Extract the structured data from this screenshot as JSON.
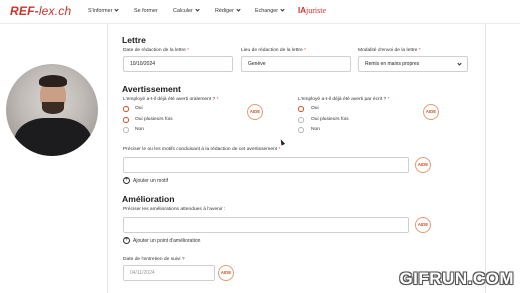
{
  "header": {
    "logo_main": "REF",
    "logo_sep": "-",
    "logo_lex": "lex.ch",
    "nav": [
      "S'informer",
      "Se former",
      "Calculer",
      "Rédiger",
      "Echanger"
    ],
    "brand_ia": "IA",
    "brand_rest": "juriste"
  },
  "lettre": {
    "title": "Lettre",
    "date_label": "Date de rédaction de la lettre",
    "date_value": "10/10/2024",
    "lieu_label": "Lieu de rédaction de la lettre",
    "lieu_value": "Genève",
    "modalite_label": "Modalité d'envoi de la lettre",
    "modalite_value": "Remis en mains propres"
  },
  "avertissement": {
    "title": "Avertissement",
    "oral_question": "L'employé a-t-il déjà été averti oralement ?",
    "ecrit_question": "L'employé a-t-il déjà été averti par écrit ?",
    "oral_options": [
      "Oui",
      "Oui plusieurs fois",
      "Non"
    ],
    "oral_selected": 1,
    "ecrit_options": [
      "Oui",
      "Oui plusieurs fois",
      "Non"
    ],
    "ecrit_selected": 0,
    "motifs_label": "Préciser le ou les motifs conduisant à la rédaction de cet avertissement",
    "add_motif": "Ajouter un motif"
  },
  "amelioration": {
    "title": "Amélioration",
    "label": "Préciser les améliorations attendues à l'avenir :",
    "add_point": "Ajouter un point d'amélioration",
    "suivi_label": "Date de l'entretien de suivi ?",
    "suivi_placeholder": "04/11/2024"
  },
  "aide_label": "AIDE",
  "required_mark": "*",
  "plus_symbol": "+",
  "watermark": "GIFRUN.COM",
  "colors": {
    "accent": "#d9522a",
    "logo": "#c8332b"
  }
}
